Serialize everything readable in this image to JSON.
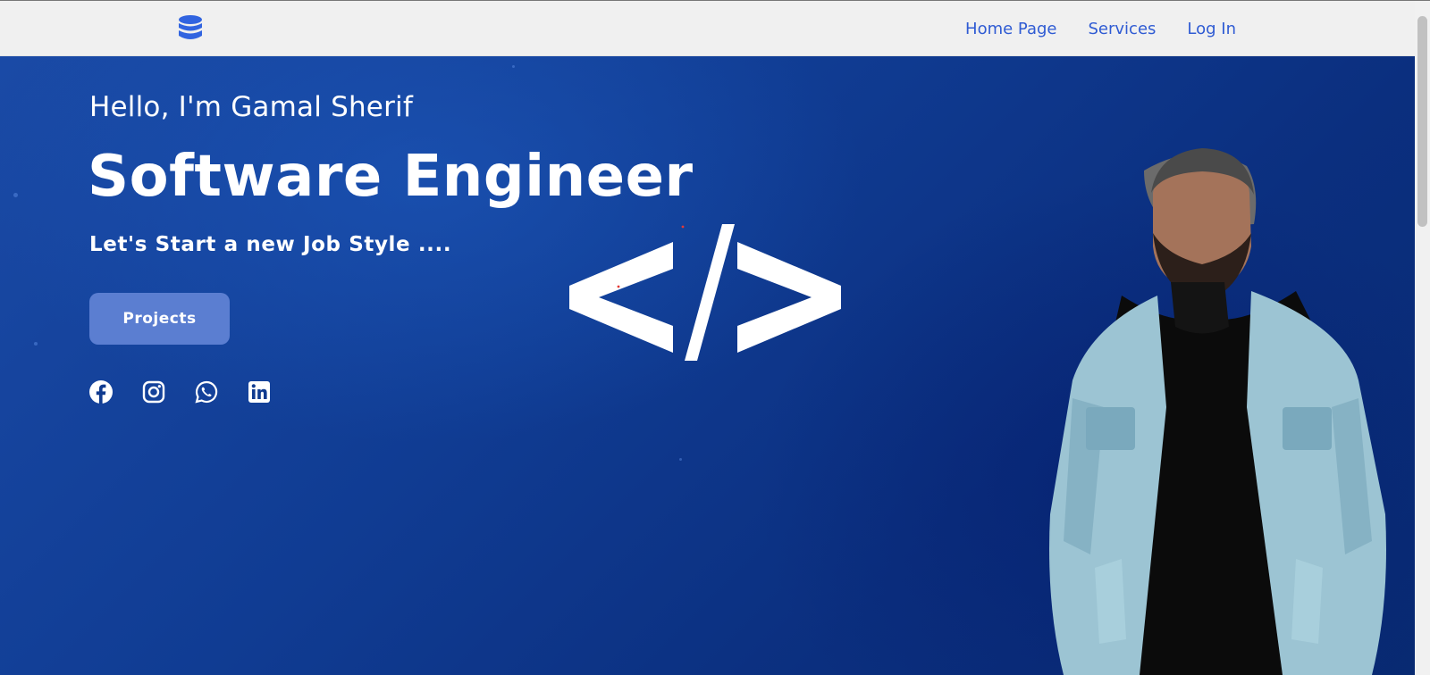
{
  "navbar": {
    "logo_icon": "database-icon",
    "links": [
      "Home Page",
      "Services",
      "Log In"
    ],
    "link_color": "#2f5bd3"
  },
  "hero": {
    "greeting": "Hello, I'm Gamal Sherif",
    "headline": "Software Engineer",
    "tagline": "Let's Start a new Job Style ....",
    "cta_label": "Projects",
    "code_symbol": "</>",
    "social_icons": [
      "facebook-icon",
      "instagram-icon",
      "whatsapp-icon",
      "linkedin-icon"
    ],
    "background_color": "#0f3a8f",
    "button_color": "#5b7ed1"
  }
}
